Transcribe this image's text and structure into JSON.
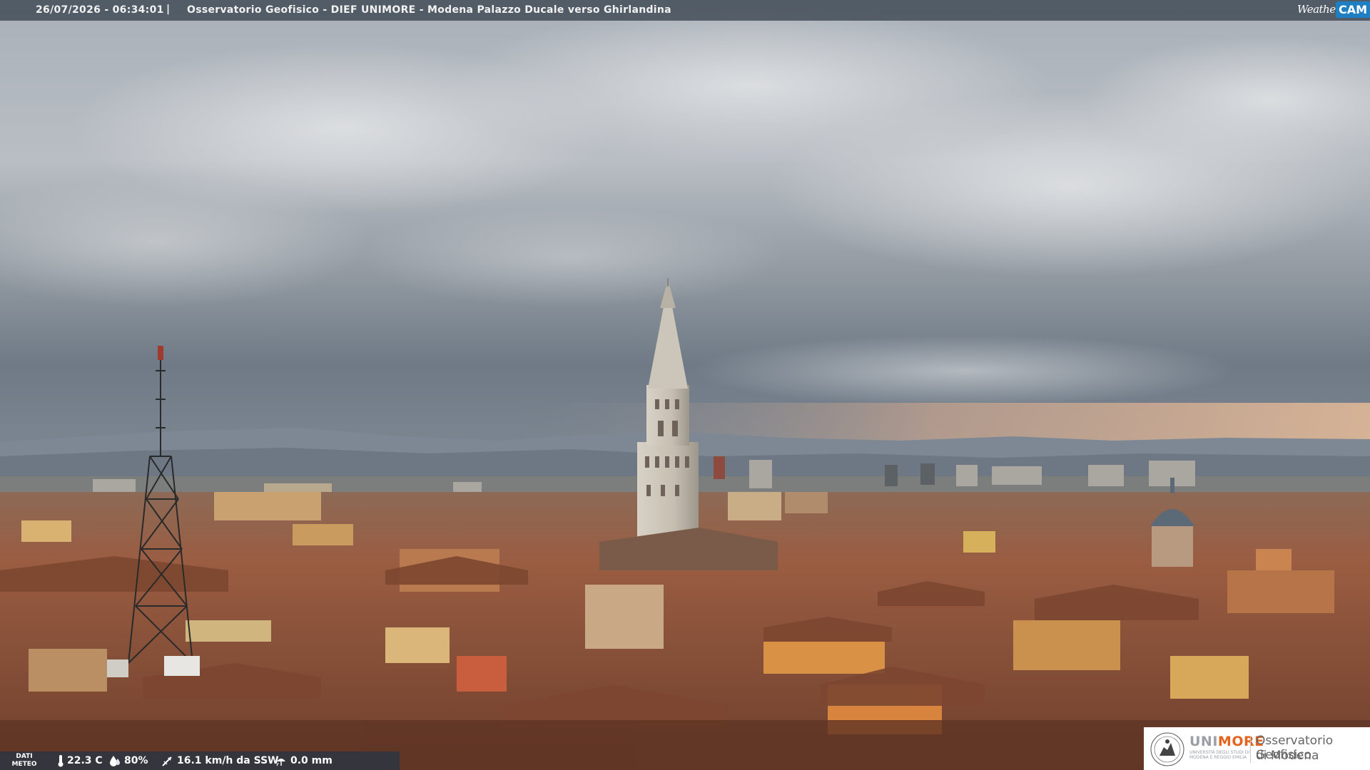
{
  "top_bar": {
    "datetime": "26/07/2026 - 06:34:01",
    "separator": "|",
    "title": "Osservatorio Geofisico - DIEF UNIMORE - Modena Palazzo Ducale verso Ghirlandina"
  },
  "brand": {
    "weather": "Weather",
    "cam": "CAM"
  },
  "weather_bar": {
    "label_line1": "DATI",
    "label_line2": "METEO",
    "temperature": "22.3 C",
    "humidity": "80%",
    "wind": "16.1 km/h da SSW",
    "rain": "0.0 mm",
    "icons": [
      "thermometer-icon",
      "humidity-drop-icon",
      "wind-direction-icon",
      "rain-gauge-icon"
    ]
  },
  "unimore": {
    "name_uni": "UNI",
    "name_more": "MORE",
    "subtitle": "UNIVERSITÀ DEGLI STUDI DI MODENA E REGGIO EMILIA",
    "observatory_line1": "Osservatorio Geofisico",
    "observatory_line2": "di Modena",
    "colors": {
      "uni": "#9aa0a6",
      "more": "#e5641f"
    }
  }
}
